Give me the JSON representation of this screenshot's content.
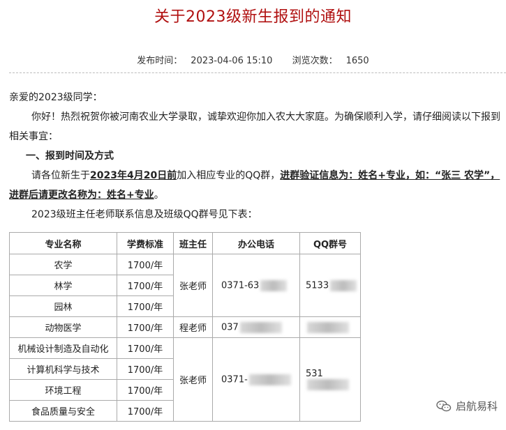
{
  "title": "关于2023级新生报到的通知",
  "meta": {
    "publish_label": "发布时间：",
    "publish_time": "2023-04-06 15:10",
    "views_label": "浏览次数：",
    "views": "1650"
  },
  "body": {
    "greeting": "亲爱的2023级同学：",
    "intro": "你好！热烈祝贺你被河南农业大学录取，诚挚欢迎你加入农大大家庭。为确保顺利入学，请仔细阅读以下报到相关事宜：",
    "section1": "一、报到时间及方式",
    "para_pre": "请各位新生于",
    "deadline": "2023年4月20日前",
    "para_mid": "加入相应专业的QQ群，",
    "rule": "进群验证信息为：姓名+专业，如：“张三 农学”，进群后请更改名称为：姓名+专业",
    "para_end": "。",
    "table_intro": "2023级班主任老师联系信息及班级QQ群号见下表："
  },
  "table": {
    "headers": [
      "专业名称",
      "学费标准",
      "班主任",
      "办公电话",
      "QQ群号"
    ],
    "rows": [
      {
        "major": "农学",
        "fee": "1700/年"
      },
      {
        "major": "林学",
        "fee": "1700/年"
      },
      {
        "major": "园林",
        "fee": "1700/年"
      },
      {
        "major": "动物医学",
        "fee": "1700/年"
      },
      {
        "major": "机械设计制造及自动化",
        "fee": "1700/年"
      },
      {
        "major": "计算机科学与技术",
        "fee": "1700/年"
      },
      {
        "major": "环境工程",
        "fee": "1700/年"
      },
      {
        "major": "食品质量与安全",
        "fee": "1700/年"
      }
    ],
    "group1": {
      "teacher": "张老师",
      "phone": "0371-63",
      "qq": "5133"
    },
    "group2": {
      "teacher": "程老师",
      "phone": "037",
      "qq": ""
    },
    "group3": {
      "teacher": "张老师",
      "phone": "0371-",
      "qq": "531"
    }
  },
  "watermark": {
    "text": "启航易科",
    "icon": "wechat-icon"
  }
}
